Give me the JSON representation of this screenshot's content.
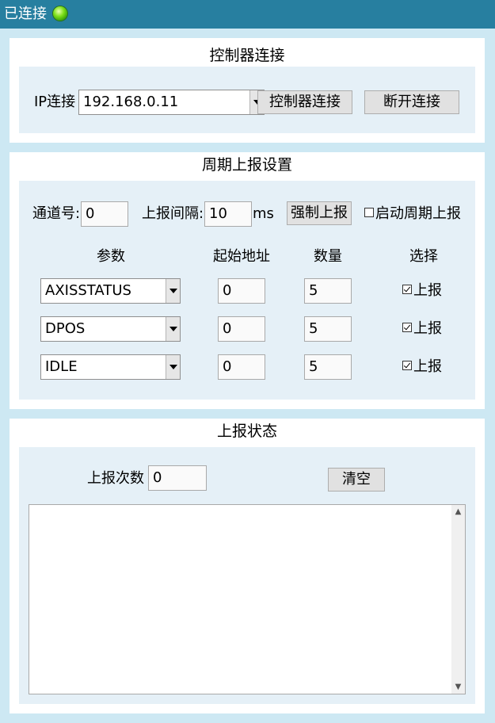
{
  "titlebar": {
    "status": "已连接",
    "indicator": "status-led-icon",
    "indicator_color": "#3fbf0f"
  },
  "controller": {
    "title": "控制器连接",
    "ip_label": "IP连接",
    "ip_value": "192.168.0.11",
    "connect_label": "控制器连接",
    "disconnect_label": "断开连接"
  },
  "report_settings": {
    "title": "周期上报设置",
    "channel_label": "通道号:",
    "channel_value": "0",
    "interval_label": "上报间隔:",
    "interval_value": "10",
    "interval_unit": "ms",
    "force_label": "强制上报",
    "periodic_label": "启动周期上报",
    "periodic_checked": false,
    "headers": {
      "param": "参数",
      "start": "起始地址",
      "count": "数量",
      "select": "选择"
    },
    "rows": [
      {
        "param": "AXISSTATUS",
        "start": "0",
        "count": "5",
        "select_label": "上报",
        "checked": true
      },
      {
        "param": "DPOS",
        "start": "0",
        "count": "5",
        "select_label": "上报",
        "checked": true
      },
      {
        "param": "IDLE",
        "start": "0",
        "count": "5",
        "select_label": "上报",
        "checked": true
      }
    ]
  },
  "report_status": {
    "title": "上报状态",
    "count_label": "上报次数",
    "count_value": "0",
    "clear_label": "清空",
    "log_text": ""
  },
  "colors": {
    "titlebar": "#277fa0",
    "background": "#cde8f3",
    "inner_panel": "#e5f0f7"
  }
}
